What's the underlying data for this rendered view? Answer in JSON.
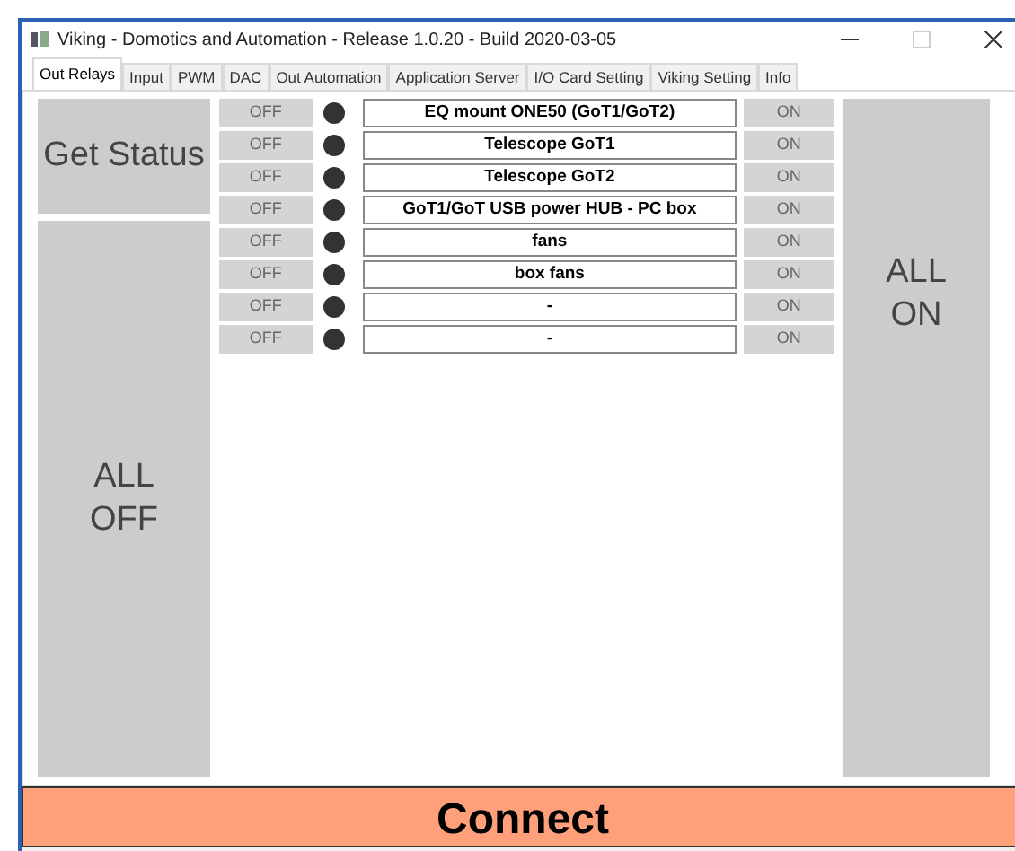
{
  "window": {
    "title": "Viking - Domotics and Automation - Release 1.0.20 - Build 2020-03-05"
  },
  "tabs": [
    {
      "label": "Out Relays",
      "selected": true
    },
    {
      "label": "Input",
      "selected": false
    },
    {
      "label": "PWM",
      "selected": false
    },
    {
      "label": "DAC",
      "selected": false
    },
    {
      "label": "Out Automation",
      "selected": false
    },
    {
      "label": "Application Server",
      "selected": false
    },
    {
      "label": "I/O Card Setting",
      "selected": false
    },
    {
      "label": "Viking Setting",
      "selected": false
    },
    {
      "label": "Info",
      "selected": false
    }
  ],
  "get_status_button": "Get Status",
  "all_off_button": "ALL OFF",
  "all_on_button": "ALL ON",
  "relays": [
    {
      "off": "OFF",
      "on": "ON",
      "name": "EQ mount ONE50 (GoT1/GoT2)",
      "active": false
    },
    {
      "off": "OFF",
      "on": "ON",
      "name": "Telescope GoT1",
      "active": false
    },
    {
      "off": "OFF",
      "on": "ON",
      "name": "Telescope GoT2",
      "active": false
    },
    {
      "off": "OFF",
      "on": "ON",
      "name": "GoT1/GoT USB power HUB - PC box",
      "active": false
    },
    {
      "off": "OFF",
      "on": "ON",
      "name": "fans",
      "active": false
    },
    {
      "off": "OFF",
      "on": "ON",
      "name": "box fans",
      "active": false
    },
    {
      "off": "OFF",
      "on": "ON",
      "name": "-",
      "active": false
    },
    {
      "off": "OFF",
      "on": "ON",
      "name": "-",
      "active": false
    }
  ],
  "connect_button": "Connect"
}
